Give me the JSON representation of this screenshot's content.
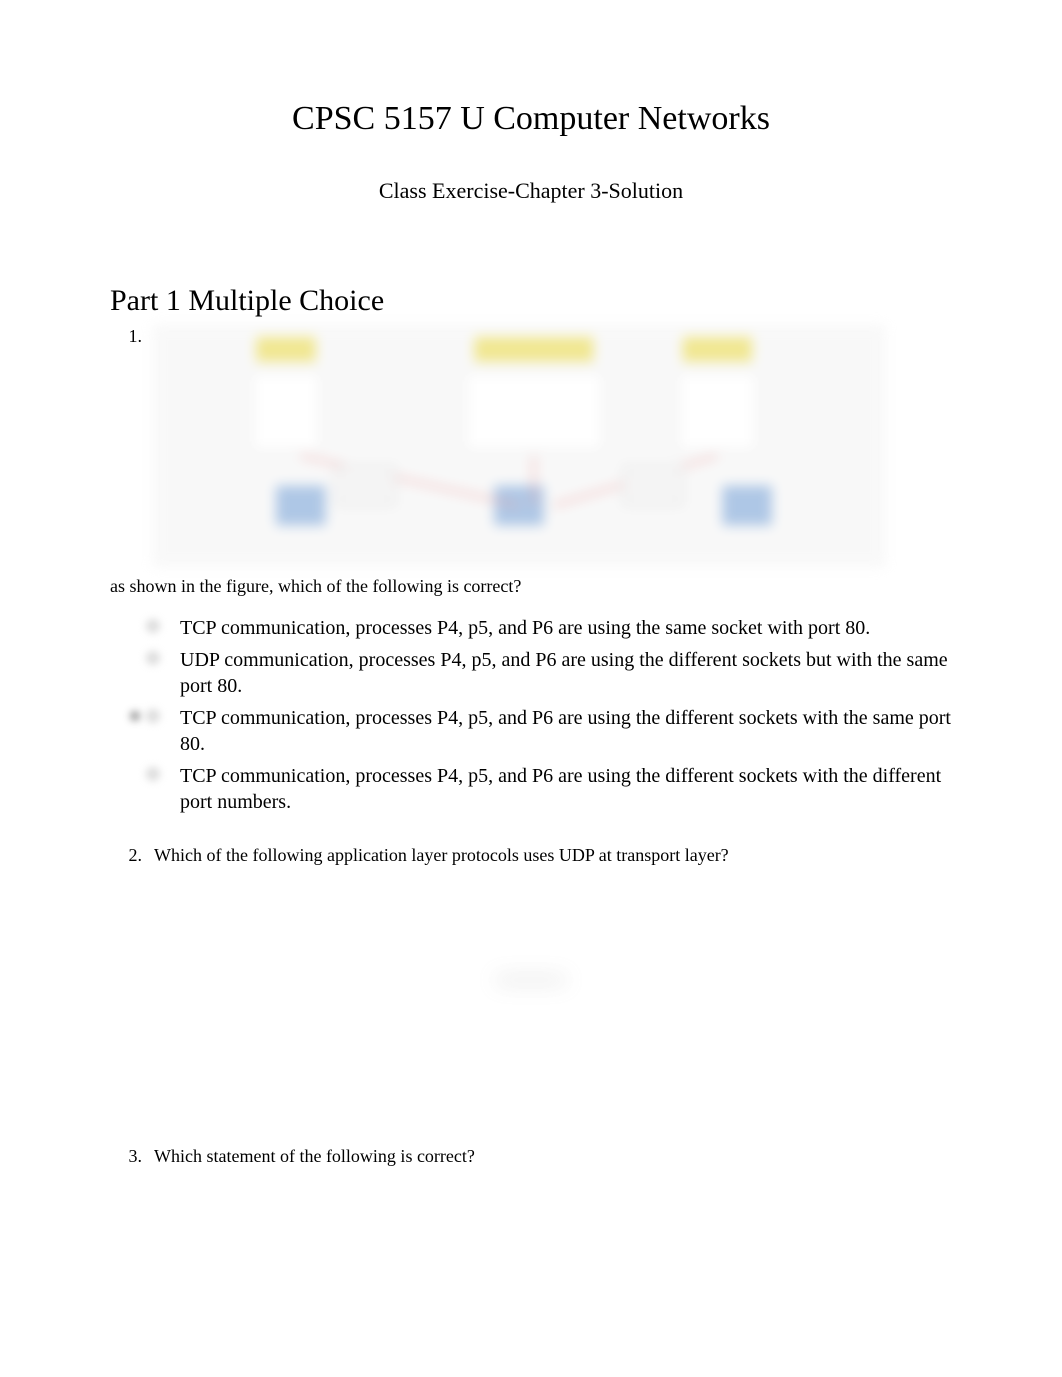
{
  "title": "CPSC 5157 U Computer Networks",
  "subtitle": "Class Exercise-Chapter 3-Solution",
  "part_heading": "Part 1 Multiple Choice",
  "q1": {
    "num": "1.",
    "caption": "as shown in the figure, which of the following is correct?",
    "options": [
      "TCP communication, processes P4, p5, and P6 are using the same socket with port 80.",
      "UDP communication, processes P4, p5, and P6 are using the different sockets but with the same port 80.",
      "TCP communication, processes P4, p5, and P6 are using the different sockets with the same port 80.",
      "TCP communication, processes P4, p5, and P6 are using the different sockets with the different port numbers."
    ]
  },
  "q2": {
    "num": "2.",
    "text": "Which of the following application layer protocols uses UDP at transport layer?"
  },
  "q3": {
    "num": "3.",
    "text": "Which statement of the following is correct?"
  }
}
